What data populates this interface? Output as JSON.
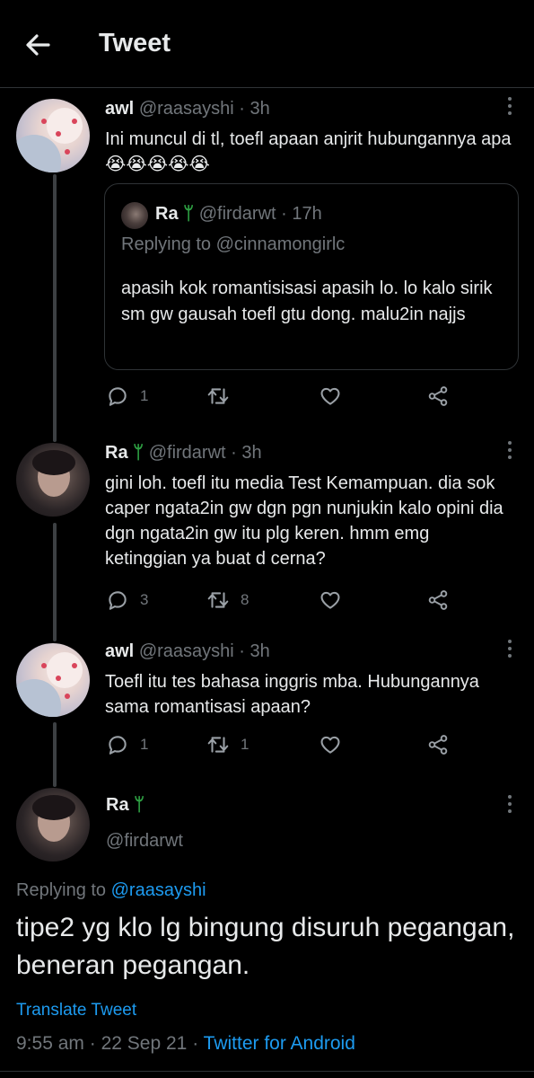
{
  "header": {
    "title": "Tweet"
  },
  "tweets": [
    {
      "name": "awl",
      "handle": "@raasayshi",
      "time": "3h",
      "text": "Ini muncul di tl, toefl apaan anjrit hubungannya apa😭😭😭😭😭",
      "quote": {
        "name": "Ra",
        "name_badge": "🌱",
        "handle": "@firdarwt",
        "time": "17h",
        "replying_to": "Replying to @cinnamongirlc",
        "text": "apasih kok romantisisasi apasih lo. lo kalo sirik sm gw gausah toefl gtu dong. malu2in najjs"
      },
      "replies": "1",
      "retweets": "",
      "likes": ""
    },
    {
      "name": "Ra",
      "name_badge": "🌱",
      "handle": "@firdarwt",
      "time": "3h",
      "text": "gini loh. toefl itu media Test Kemampuan. dia sok caper ngata2in gw dgn pgn nunjukin kalo opini dia dgn ngata2in gw itu plg keren. hmm emg ketinggian ya buat d cerna?",
      "replies": "3",
      "retweets": "8",
      "likes": ""
    },
    {
      "name": "awl",
      "handle": "@raasayshi",
      "time": "3h",
      "text": "Toefl itu tes bahasa inggris mba. Hubungannya sama romantisasi apaan?",
      "replies": "1",
      "retweets": "1",
      "likes": ""
    }
  ],
  "main_tweet": {
    "name": "Ra",
    "name_badge": "🌱",
    "handle": "@firdarwt",
    "replying_prefix": "Replying to",
    "replying_handle": "@raasayshi",
    "text": "tipe2 yg klo lg bingung disuruh pegangan, beneran pegangan.",
    "translate_label": "Translate Tweet",
    "time": "9:55 am",
    "date": "22 Sep 21",
    "source": "Twitter for Android"
  },
  "colors": {
    "accent": "#1d9bf0",
    "muted": "#71767b",
    "background": "#000000",
    "divider": "#2f3336"
  },
  "icons": [
    "back-arrow-icon",
    "more-icon",
    "reply-icon",
    "retweet-icon",
    "like-icon",
    "share-icon"
  ]
}
